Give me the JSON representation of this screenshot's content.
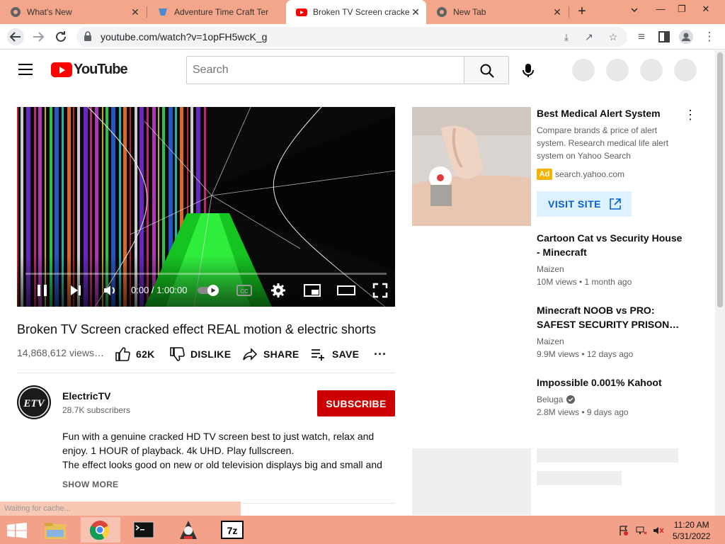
{
  "browser": {
    "tabs": [
      {
        "title": "What's New",
        "active": false
      },
      {
        "title": "Adventure Time Craft Ter",
        "active": false
      },
      {
        "title": "Broken TV Screen cracke",
        "active": true
      },
      {
        "title": "New Tab",
        "active": false
      }
    ],
    "url": "youtube.com/watch?v=1opFH5wcK_g"
  },
  "youtube": {
    "logo_text": "YouTube",
    "search_placeholder": "Search"
  },
  "player": {
    "time": "0:00 / 1:00:00",
    "progress": 0.0
  },
  "video": {
    "title": "Broken TV Screen cracked effect REAL motion & electric shorts",
    "views": "14,868,612 views…",
    "likes": "62K",
    "dislike_label": "DISLIKE",
    "share_label": "SHARE",
    "save_label": "SAVE"
  },
  "channel": {
    "name": "ElectricTV",
    "avatar_text": "ETV",
    "subscribers": "28.7K subscribers",
    "subscribe_label": "SUBSCRIBE",
    "description_lines": [
      "Fun with a genuine cracked HD TV screen best to just watch, relax and",
      "enjoy.  1 HOUR of playback. 4k UHD. Play fullscreen.",
      "The effect looks good on new or old television displays big and small and"
    ],
    "show_more": "SHOW MORE"
  },
  "status_bar": "Waiting for cache...",
  "ad": {
    "title": "Best Medical Alert System",
    "description": "Compare brands & price of alert system. Research medical life alert system on Yahoo Search",
    "badge": "Ad",
    "domain": "search.yahoo.com",
    "cta": "VISIT SITE"
  },
  "recommendations": [
    {
      "title": "Cartoon Cat vs Security House - Minecraft",
      "channel": "Maizen",
      "meta": "10M views • 1 month ago"
    },
    {
      "title": "Minecraft NOOB vs PRO: SAFEST SECURITY PRISON…",
      "channel": "Maizen",
      "meta": "9.9M views • 12 days ago"
    },
    {
      "title": "Impossible 0.001% Kahoot",
      "channel": "Beluga",
      "meta": "2.8M views • 9 days ago",
      "verified": true
    }
  ],
  "taskbar": {
    "time": "11:20 AM",
    "date": "5/31/2022",
    "archive_label": "7z"
  }
}
